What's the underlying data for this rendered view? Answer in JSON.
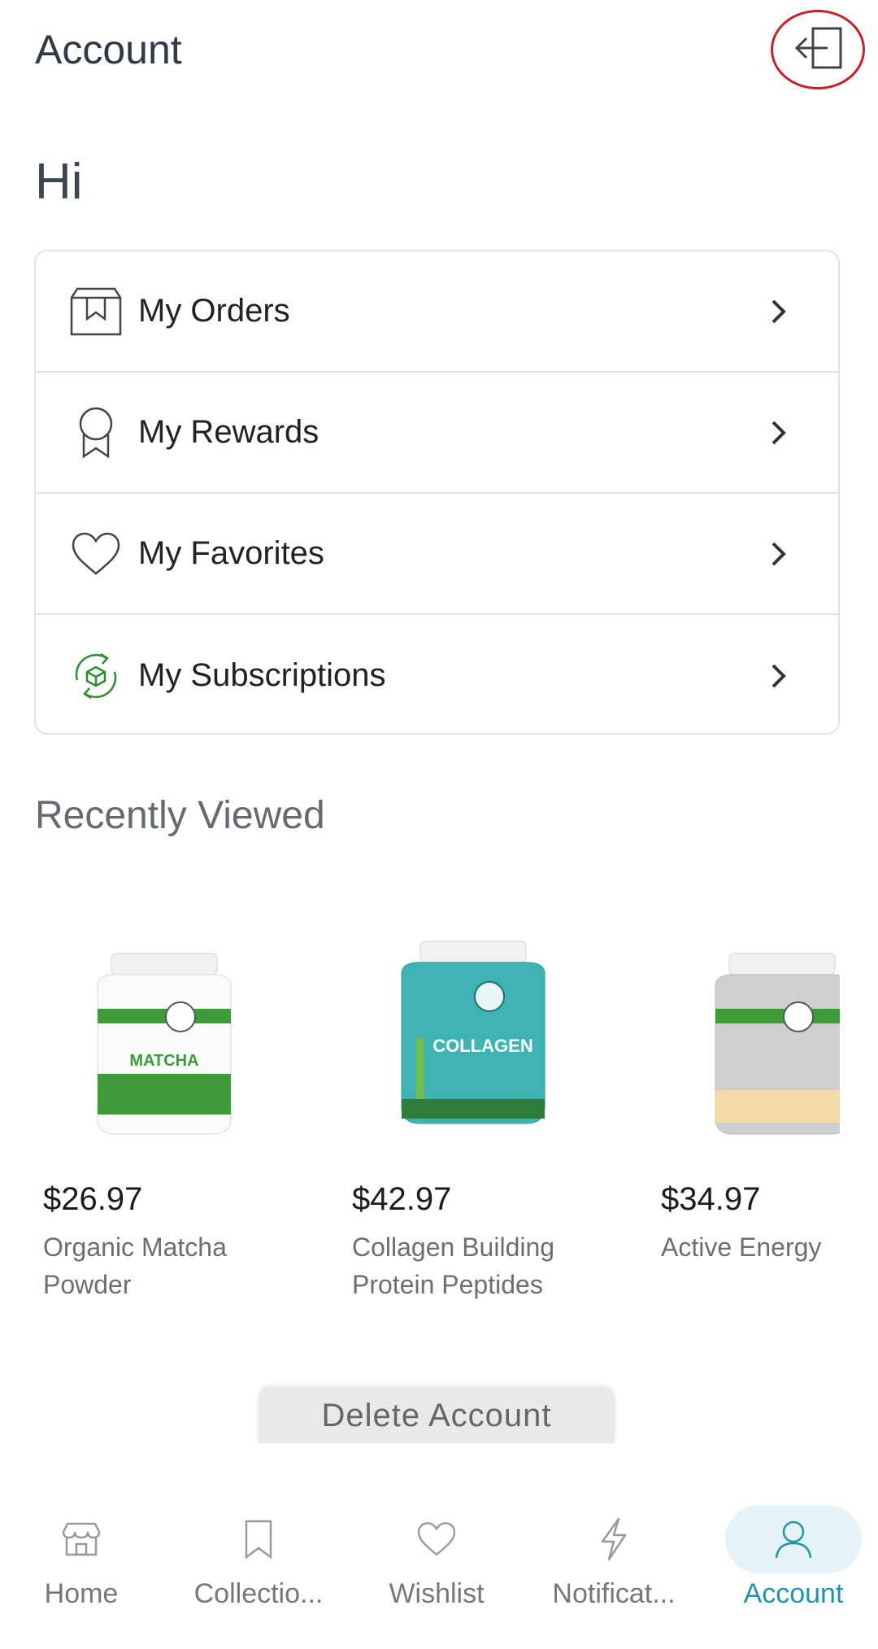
{
  "header": {
    "title": "Account",
    "logout_icon": "logout-icon"
  },
  "greeting": "Hi",
  "menu": [
    {
      "label": "My Orders",
      "icon": "orders-box-icon"
    },
    {
      "label": "My Rewards",
      "icon": "ribbon-award-icon"
    },
    {
      "label": "My Favorites",
      "icon": "heart-icon"
    },
    {
      "label": "My Subscriptions",
      "icon": "subscription-cycle-icon"
    }
  ],
  "recently_viewed": {
    "title": "Recently Viewed",
    "products": [
      {
        "price": "$26.97",
        "name": "Organic Matcha Powder",
        "label_color": "#3f9a3a"
      },
      {
        "price": "$42.97",
        "name": "Collagen Building Protein Peptides",
        "label_color": "#3db3b4"
      },
      {
        "price": "$34.97",
        "name": "Active Energy",
        "label_color": "#c9c9c9"
      }
    ]
  },
  "delete_account_label": "Delete Account",
  "tabs": [
    {
      "label": "Home",
      "icon": "store-icon"
    },
    {
      "label": "Collectio...",
      "icon": "bookmark-icon"
    },
    {
      "label": "Wishlist",
      "icon": "heart-icon"
    },
    {
      "label": "Notificat...",
      "icon": "lightning-icon"
    },
    {
      "label": "Account",
      "icon": "user-icon",
      "active": true
    }
  ],
  "colors": {
    "accent": "#2592ad",
    "accent_bg": "#e4f3f8",
    "logout_highlight": "#c8202a"
  }
}
